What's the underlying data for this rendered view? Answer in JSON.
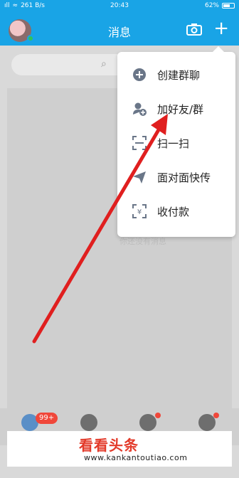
{
  "status_bar": {
    "signal": "ıll",
    "speed": "261 B/s",
    "time": "20:43",
    "battery": "62%"
  },
  "header": {
    "title": "消息"
  },
  "menu": {
    "items": [
      {
        "label": "创建群聊",
        "icon": "chat-plus-icon"
      },
      {
        "label": "加好友/群",
        "icon": "add-friend-icon"
      },
      {
        "label": "扫一扫",
        "icon": "scan-icon"
      },
      {
        "label": "面对面快传",
        "icon": "send-icon"
      },
      {
        "label": "收付款",
        "icon": "payment-icon"
      }
    ]
  },
  "content": {
    "ghost_text": "你还没有消息"
  },
  "tabbar": {
    "badge": "99+"
  },
  "watermark": {
    "logo": "看看头条",
    "url": "www.kankantoutiao.com"
  },
  "colors": {
    "brand": "#19a4e6",
    "badge": "#f0473a",
    "arrow": "#e01f1f"
  }
}
